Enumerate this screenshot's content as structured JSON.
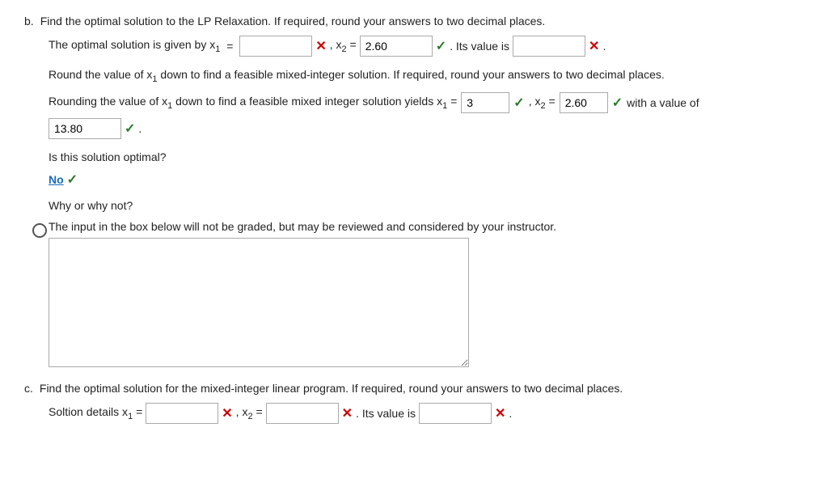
{
  "partB": {
    "label": "b.",
    "intro": "Find the optimal solution to the LP Relaxation. If required, round your answers to two decimal places.",
    "line1_pre": "The optimal solution is given by x",
    "line1_sub1": "1",
    "line1_mid": "=",
    "line1_x2": ", x",
    "line1_sub2": "2",
    "line1_eq": "=",
    "x2_value": "2.60",
    "line1_its": ". Its value is",
    "line1_x_end": ".",
    "round_text": "Round the value of x",
    "round_sub": "1",
    "round_rest": "down to find a feasible mixed-integer solution. If required, round your answers to two decimal places.",
    "rounding_pre": "Rounding the value of x",
    "rounding_sub": "1",
    "rounding_mid": "down to find a feasible mixed integer solution yields x",
    "rounding_sub2": "1",
    "rounding_eq": "=",
    "x1_rnd_value": "3",
    "rounding_x2": ", x",
    "rounding_sub3": "2",
    "rounding_eq2": "=",
    "x2_rnd_value": "2.60",
    "with_value_of": "with a value of",
    "obj_value": "13.80",
    "is_optimal_q": "Is this solution optimal?",
    "answer_no": "No",
    "why_label": "Why or why not?",
    "ungraded_note": "The input in the box below will not be graded, but may be reviewed and considered by your instructor."
  },
  "partC": {
    "label": "c.",
    "intro": "Find the optimal solution for the mixed-integer linear program. If required, round your answers to two decimal places.",
    "solution_pre": "Soltion details x",
    "solution_sub1": "1",
    "solution_eq1": "=",
    "solution_x2": ", x",
    "solution_sub2": "2",
    "solution_eq2": "=",
    "solution_x_end": ".",
    "its_value_is": "Its value is",
    "its_value_x": "."
  },
  "icons": {
    "check": "✓",
    "x_mark": "✕"
  }
}
